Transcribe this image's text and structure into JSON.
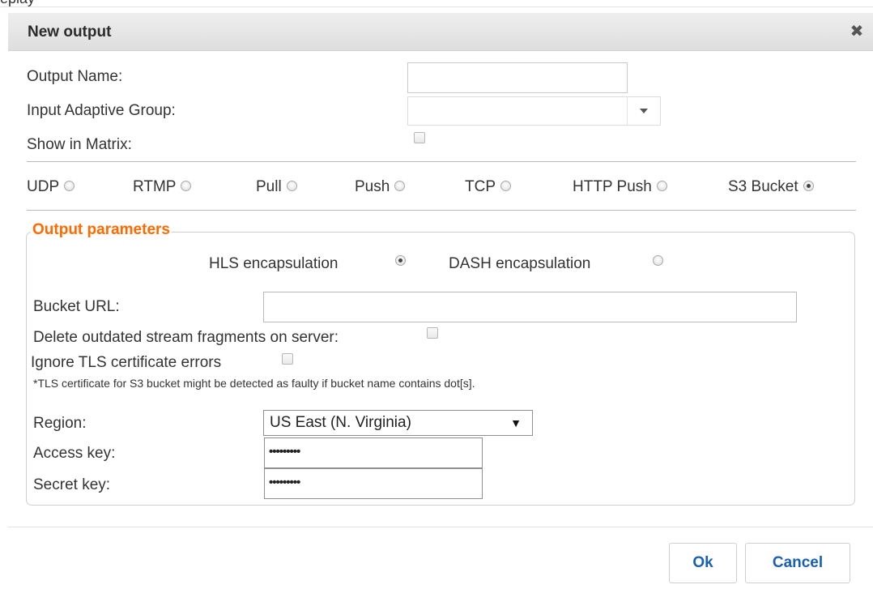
{
  "page": {
    "top_fragment": "eplay"
  },
  "dialog": {
    "title": "New output",
    "close_icon": "close-icon"
  },
  "form": {
    "output_name_label": "Output Name:",
    "output_name_value": "",
    "input_adaptive_group_label": "Input Adaptive Group:",
    "input_adaptive_group_value": "",
    "show_in_matrix_label": "Show in Matrix:",
    "show_in_matrix_checked": false
  },
  "output_types": [
    {
      "label": "UDP",
      "selected": false
    },
    {
      "label": "RTMP",
      "selected": false
    },
    {
      "label": "Pull",
      "selected": false
    },
    {
      "label": "Push",
      "selected": false
    },
    {
      "label": "TCP",
      "selected": false
    },
    {
      "label": "HTTP Push",
      "selected": false
    },
    {
      "label": "S3 Bucket",
      "selected": true
    }
  ],
  "params": {
    "legend": "Output parameters",
    "hls_label": "HLS encapsulation",
    "hls_selected": true,
    "dash_label": "DASH encapsulation",
    "dash_selected": false,
    "bucket_url_label": "Bucket URL:",
    "bucket_url_value": "",
    "delete_fragments_label": "Delete outdated stream fragments on server:",
    "delete_fragments_checked": false,
    "ignore_tls_label": "Ignore TLS certificate errors",
    "ignore_tls_checked": false,
    "tls_note": "*TLS certificate for S3 bucket might be detected as faulty if bucket name contains dot[s].",
    "region_label": "Region:",
    "region_value": "US East (N. Virginia)",
    "access_key_label": "Access key:",
    "access_key_value": "•••••••••",
    "secret_key_label": "Secret key:",
    "secret_key_value": "•••••••••"
  },
  "buttons": {
    "ok": "Ok",
    "cancel": "Cancel"
  },
  "colors": {
    "legend": "#ff6a00",
    "button_text": "#1b5fb3"
  }
}
